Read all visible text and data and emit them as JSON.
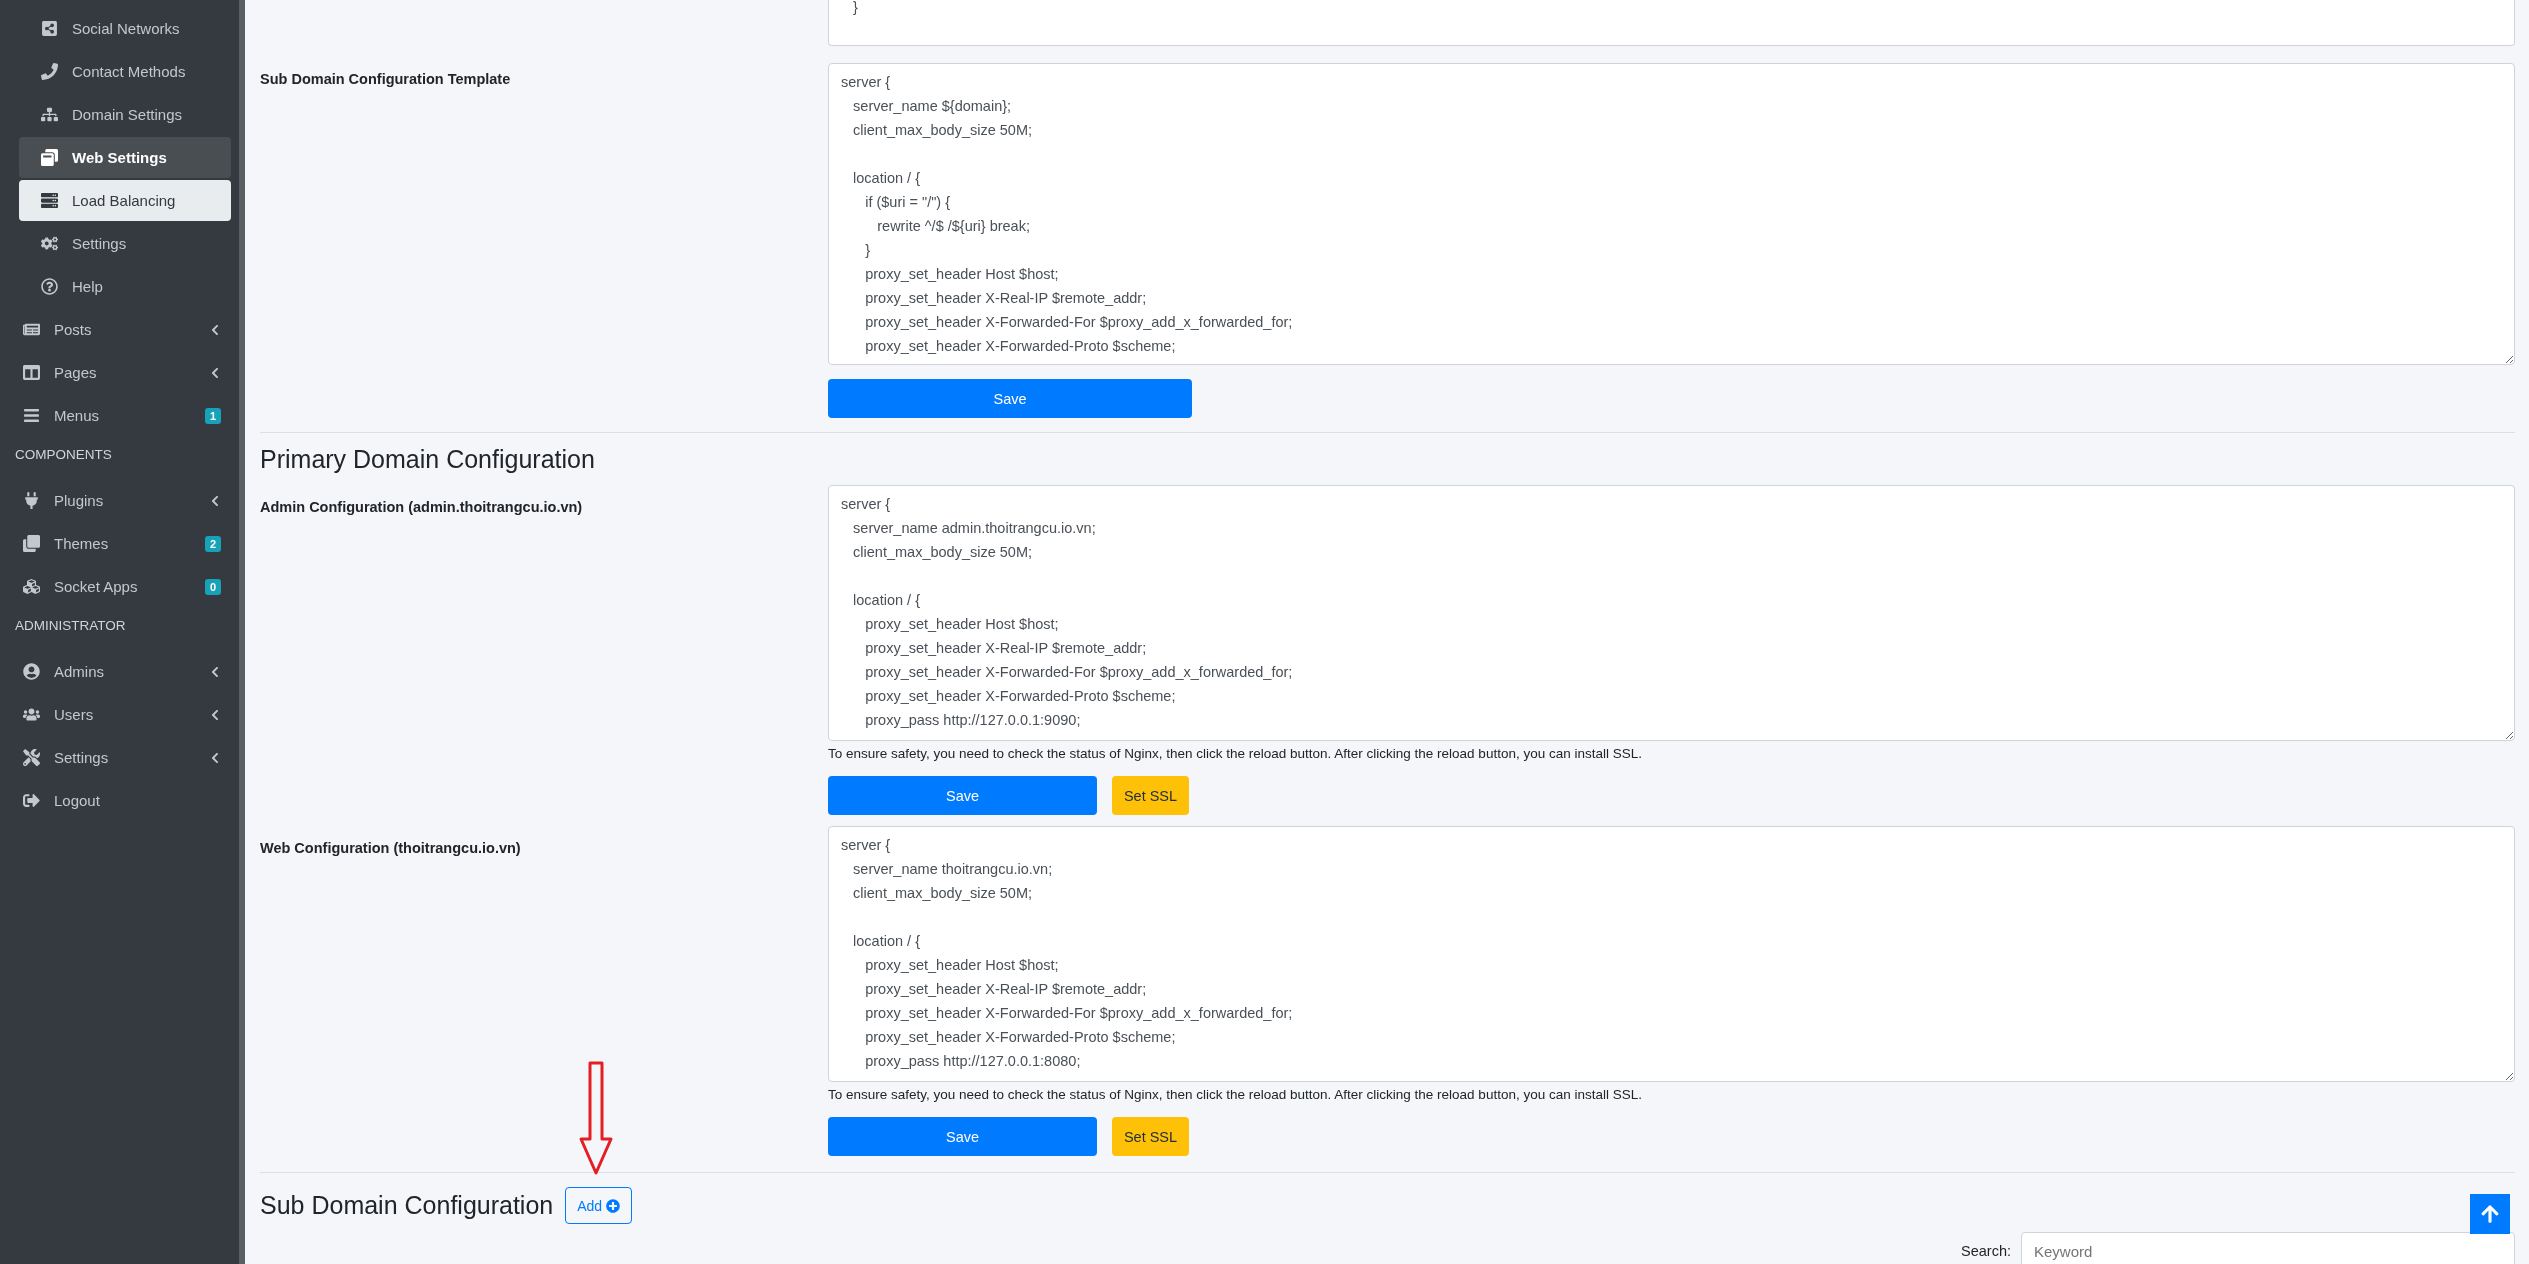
{
  "sidebar": {
    "submenu_items": [
      {
        "label": "Social Networks",
        "selected": false,
        "highlighted": false
      },
      {
        "label": "Contact Methods",
        "selected": false,
        "highlighted": false
      },
      {
        "label": "Domain Settings",
        "selected": false,
        "highlighted": false
      },
      {
        "label": "Web Settings",
        "selected": false,
        "highlighted": true
      },
      {
        "label": "Load Balancing",
        "selected": true,
        "highlighted": false
      },
      {
        "label": "Settings",
        "selected": false,
        "highlighted": false
      },
      {
        "label": "Help",
        "selected": false,
        "highlighted": false
      }
    ],
    "items": [
      {
        "kind": "link",
        "label": "Posts",
        "has_submenu": true
      },
      {
        "kind": "link",
        "label": "Pages",
        "has_submenu": true
      },
      {
        "kind": "link",
        "label": "Menus",
        "badge": "1"
      },
      {
        "kind": "header",
        "label": "COMPONENTS"
      },
      {
        "kind": "link",
        "label": "Plugins",
        "has_submenu": true
      },
      {
        "kind": "link",
        "label": "Themes",
        "badge": "2"
      },
      {
        "kind": "link",
        "label": "Socket Apps",
        "badge": "0"
      },
      {
        "kind": "header",
        "label": "ADMINISTRATOR"
      },
      {
        "kind": "link",
        "label": "Admins",
        "has_submenu": true
      },
      {
        "kind": "link",
        "label": "Users",
        "has_submenu": true
      },
      {
        "kind": "link",
        "label": "Settings",
        "has_submenu": true
      },
      {
        "kind": "link",
        "label": "Logout"
      }
    ]
  },
  "main": {
    "top_config": {
      "code": "   }"
    },
    "sub_domain_template": {
      "label": "Sub Domain Configuration Template",
      "save_label": "Save",
      "code": "server {\n   server_name ${domain};\n   client_max_body_size 50M;\n\n   location / {\n      if ($uri = \"/\") {\n         rewrite ^/$ /${uri} break;\n      }\n      proxy_set_header Host $host;\n      proxy_set_header X-Real-IP $remote_addr;\n      proxy_set_header X-Forwarded-For $proxy_add_x_forwarded_for;\n      proxy_set_header X-Forwarded-Proto $scheme;"
    },
    "primary_section": {
      "title": "Primary Domain Configuration",
      "configs": [
        {
          "label": "Admin Configuration (admin.thoitrangcu.io.vn)",
          "note": "To ensure safety, you need to check the status of Nginx, then click the reload button. After clicking the reload button, you can install SSL.",
          "save_label": "Save",
          "ssl_label": "Set SSL",
          "code": "server {\n   server_name admin.thoitrangcu.io.vn;\n   client_max_body_size 50M;\n\n   location / {\n      proxy_set_header Host $host;\n      proxy_set_header X-Real-IP $remote_addr;\n      proxy_set_header X-Forwarded-For $proxy_add_x_forwarded_for;\n      proxy_set_header X-Forwarded-Proto $scheme;\n      proxy_pass http://127.0.0.1:9090;"
        },
        {
          "label": "Web Configuration (thoitrangcu.io.vn)",
          "note": "To ensure safety, you need to check the status of Nginx, then click the reload button. After clicking the reload button, you can install SSL.",
          "save_label": "Save",
          "ssl_label": "Set SSL",
          "code": "server {\n   server_name thoitrangcu.io.vn;\n   client_max_body_size 50M;\n\n   location / {\n      proxy_set_header Host $host;\n      proxy_set_header X-Real-IP $remote_addr;\n      proxy_set_header X-Forwarded-For $proxy_add_x_forwarded_for;\n      proxy_set_header X-Forwarded-Proto $scheme;\n      proxy_pass http://127.0.0.1:8080;"
        }
      ]
    },
    "sub_domain_section": {
      "title": "Sub Domain Configuration",
      "add_label": "Add",
      "search_label": "Search:",
      "search_placeholder": "Keyword"
    }
  }
}
